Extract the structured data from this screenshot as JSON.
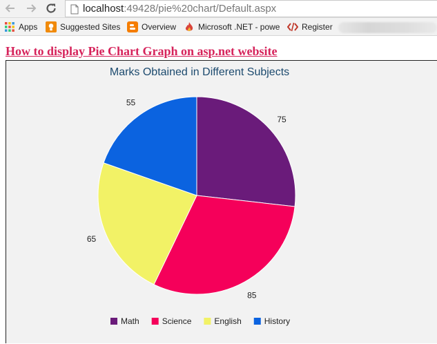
{
  "browser": {
    "url_host": "localhost",
    "url_rest": ":49428/pie%20chart/Default.aspx"
  },
  "bookmarks": [
    {
      "label": "Apps",
      "icon": "apps-grid-icon"
    },
    {
      "label": "Suggested Sites",
      "icon": "suggested-sites-icon"
    },
    {
      "label": "Overview",
      "icon": "blogger-icon"
    },
    {
      "label": "Microsoft .NET - powe",
      "icon": "fire-icon"
    },
    {
      "label": "Register",
      "icon": "code-icon"
    }
  ],
  "page": {
    "heading": "How to display Pie Chart Graph on asp.net website"
  },
  "colors": {
    "heading": "#d6235b",
    "chart_background": "#f2f2f2",
    "title": "#1c4a6e"
  },
  "chart_data": {
    "type": "pie",
    "title": "Marks Obtained in Different Subjects",
    "categories": [
      "Math",
      "Science",
      "English",
      "History"
    ],
    "values": [
      75,
      85,
      65,
      55
    ],
    "colors": [
      "#6a1b7a",
      "#f5005a",
      "#f2f266",
      "#0b63e0"
    ],
    "legend": "bottom",
    "start_angle": "12 o'clock, clockwise"
  }
}
